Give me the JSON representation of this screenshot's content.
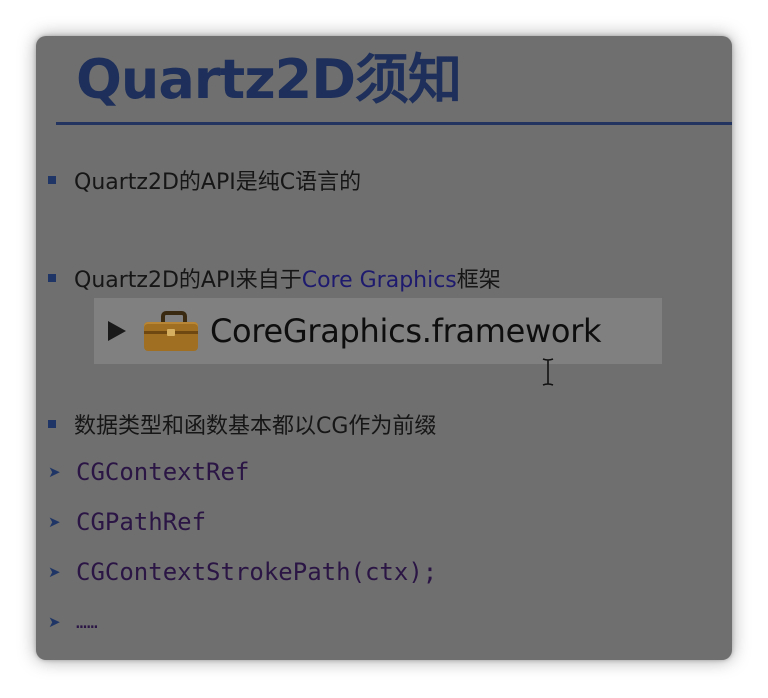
{
  "slide": {
    "title": "Quartz2D须知",
    "bullets": [
      {
        "text": "Quartz2D的API是纯C语言的"
      },
      {
        "text_before": "Quartz2D的API来自于",
        "highlight": "Core Graphics",
        "text_after": "框架"
      },
      {
        "text": "数据类型和函数基本都以CG作为前缀"
      }
    ],
    "framework_item": {
      "label": "CoreGraphics.framework",
      "icon": "briefcase-icon"
    },
    "code_items": [
      "CGContextRef",
      "CGPathRef",
      "CGContextStrokePath(ctx);",
      "……"
    ]
  },
  "colors": {
    "background": "#6f6f6f",
    "title": "#1d2f5a",
    "bullet_marker": "#1f3566",
    "highlight": "#1e1a6e",
    "code": "#2a1545"
  }
}
